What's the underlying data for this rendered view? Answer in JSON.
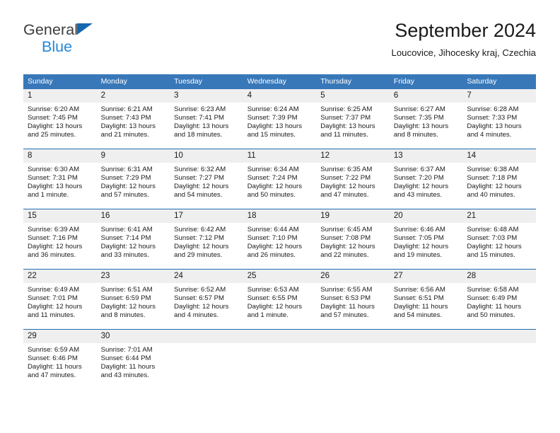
{
  "brand": {
    "name_part1": "General",
    "name_part2": "Blue",
    "triangle_icon": "triangle-icon",
    "accent_color": "#2387d6",
    "triangle_color": "#1567b0"
  },
  "header": {
    "title": "September 2024",
    "subtitle": "Loucovice, Jihocesky kraj, Czechia"
  },
  "calendar": {
    "header_bg": "#3878b9",
    "header_text_color": "#ffffff",
    "row_divider_color": "#1f6cb0",
    "daynum_bg": "#efefef",
    "weekdays": [
      "Sunday",
      "Monday",
      "Tuesday",
      "Wednesday",
      "Thursday",
      "Friday",
      "Saturday"
    ],
    "weeks": [
      [
        {
          "day": "1",
          "sunrise": "Sunrise: 6:20 AM",
          "sunset": "Sunset: 7:45 PM",
          "daylight_line1": "Daylight: 13 hours",
          "daylight_line2": "and 25 minutes."
        },
        {
          "day": "2",
          "sunrise": "Sunrise: 6:21 AM",
          "sunset": "Sunset: 7:43 PM",
          "daylight_line1": "Daylight: 13 hours",
          "daylight_line2": "and 21 minutes."
        },
        {
          "day": "3",
          "sunrise": "Sunrise: 6:23 AM",
          "sunset": "Sunset: 7:41 PM",
          "daylight_line1": "Daylight: 13 hours",
          "daylight_line2": "and 18 minutes."
        },
        {
          "day": "4",
          "sunrise": "Sunrise: 6:24 AM",
          "sunset": "Sunset: 7:39 PM",
          "daylight_line1": "Daylight: 13 hours",
          "daylight_line2": "and 15 minutes."
        },
        {
          "day": "5",
          "sunrise": "Sunrise: 6:25 AM",
          "sunset": "Sunset: 7:37 PM",
          "daylight_line1": "Daylight: 13 hours",
          "daylight_line2": "and 11 minutes."
        },
        {
          "day": "6",
          "sunrise": "Sunrise: 6:27 AM",
          "sunset": "Sunset: 7:35 PM",
          "daylight_line1": "Daylight: 13 hours",
          "daylight_line2": "and 8 minutes."
        },
        {
          "day": "7",
          "sunrise": "Sunrise: 6:28 AM",
          "sunset": "Sunset: 7:33 PM",
          "daylight_line1": "Daylight: 13 hours",
          "daylight_line2": "and 4 minutes."
        }
      ],
      [
        {
          "day": "8",
          "sunrise": "Sunrise: 6:30 AM",
          "sunset": "Sunset: 7:31 PM",
          "daylight_line1": "Daylight: 13 hours",
          "daylight_line2": "and 1 minute."
        },
        {
          "day": "9",
          "sunrise": "Sunrise: 6:31 AM",
          "sunset": "Sunset: 7:29 PM",
          "daylight_line1": "Daylight: 12 hours",
          "daylight_line2": "and 57 minutes."
        },
        {
          "day": "10",
          "sunrise": "Sunrise: 6:32 AM",
          "sunset": "Sunset: 7:27 PM",
          "daylight_line1": "Daylight: 12 hours",
          "daylight_line2": "and 54 minutes."
        },
        {
          "day": "11",
          "sunrise": "Sunrise: 6:34 AM",
          "sunset": "Sunset: 7:24 PM",
          "daylight_line1": "Daylight: 12 hours",
          "daylight_line2": "and 50 minutes."
        },
        {
          "day": "12",
          "sunrise": "Sunrise: 6:35 AM",
          "sunset": "Sunset: 7:22 PM",
          "daylight_line1": "Daylight: 12 hours",
          "daylight_line2": "and 47 minutes."
        },
        {
          "day": "13",
          "sunrise": "Sunrise: 6:37 AM",
          "sunset": "Sunset: 7:20 PM",
          "daylight_line1": "Daylight: 12 hours",
          "daylight_line2": "and 43 minutes."
        },
        {
          "day": "14",
          "sunrise": "Sunrise: 6:38 AM",
          "sunset": "Sunset: 7:18 PM",
          "daylight_line1": "Daylight: 12 hours",
          "daylight_line2": "and 40 minutes."
        }
      ],
      [
        {
          "day": "15",
          "sunrise": "Sunrise: 6:39 AM",
          "sunset": "Sunset: 7:16 PM",
          "daylight_line1": "Daylight: 12 hours",
          "daylight_line2": "and 36 minutes."
        },
        {
          "day": "16",
          "sunrise": "Sunrise: 6:41 AM",
          "sunset": "Sunset: 7:14 PM",
          "daylight_line1": "Daylight: 12 hours",
          "daylight_line2": "and 33 minutes."
        },
        {
          "day": "17",
          "sunrise": "Sunrise: 6:42 AM",
          "sunset": "Sunset: 7:12 PM",
          "daylight_line1": "Daylight: 12 hours",
          "daylight_line2": "and 29 minutes."
        },
        {
          "day": "18",
          "sunrise": "Sunrise: 6:44 AM",
          "sunset": "Sunset: 7:10 PM",
          "daylight_line1": "Daylight: 12 hours",
          "daylight_line2": "and 26 minutes."
        },
        {
          "day": "19",
          "sunrise": "Sunrise: 6:45 AM",
          "sunset": "Sunset: 7:08 PM",
          "daylight_line1": "Daylight: 12 hours",
          "daylight_line2": "and 22 minutes."
        },
        {
          "day": "20",
          "sunrise": "Sunrise: 6:46 AM",
          "sunset": "Sunset: 7:05 PM",
          "daylight_line1": "Daylight: 12 hours",
          "daylight_line2": "and 19 minutes."
        },
        {
          "day": "21",
          "sunrise": "Sunrise: 6:48 AM",
          "sunset": "Sunset: 7:03 PM",
          "daylight_line1": "Daylight: 12 hours",
          "daylight_line2": "and 15 minutes."
        }
      ],
      [
        {
          "day": "22",
          "sunrise": "Sunrise: 6:49 AM",
          "sunset": "Sunset: 7:01 PM",
          "daylight_line1": "Daylight: 12 hours",
          "daylight_line2": "and 11 minutes."
        },
        {
          "day": "23",
          "sunrise": "Sunrise: 6:51 AM",
          "sunset": "Sunset: 6:59 PM",
          "daylight_line1": "Daylight: 12 hours",
          "daylight_line2": "and 8 minutes."
        },
        {
          "day": "24",
          "sunrise": "Sunrise: 6:52 AM",
          "sunset": "Sunset: 6:57 PM",
          "daylight_line1": "Daylight: 12 hours",
          "daylight_line2": "and 4 minutes."
        },
        {
          "day": "25",
          "sunrise": "Sunrise: 6:53 AM",
          "sunset": "Sunset: 6:55 PM",
          "daylight_line1": "Daylight: 12 hours",
          "daylight_line2": "and 1 minute."
        },
        {
          "day": "26",
          "sunrise": "Sunrise: 6:55 AM",
          "sunset": "Sunset: 6:53 PM",
          "daylight_line1": "Daylight: 11 hours",
          "daylight_line2": "and 57 minutes."
        },
        {
          "day": "27",
          "sunrise": "Sunrise: 6:56 AM",
          "sunset": "Sunset: 6:51 PM",
          "daylight_line1": "Daylight: 11 hours",
          "daylight_line2": "and 54 minutes."
        },
        {
          "day": "28",
          "sunrise": "Sunrise: 6:58 AM",
          "sunset": "Sunset: 6:49 PM",
          "daylight_line1": "Daylight: 11 hours",
          "daylight_line2": "and 50 minutes."
        }
      ],
      [
        {
          "day": "29",
          "sunrise": "Sunrise: 6:59 AM",
          "sunset": "Sunset: 6:46 PM",
          "daylight_line1": "Daylight: 11 hours",
          "daylight_line2": "and 47 minutes."
        },
        {
          "day": "30",
          "sunrise": "Sunrise: 7:01 AM",
          "sunset": "Sunset: 6:44 PM",
          "daylight_line1": "Daylight: 11 hours",
          "daylight_line2": "and 43 minutes."
        },
        {
          "day": "",
          "sunrise": "",
          "sunset": "",
          "daylight_line1": "",
          "daylight_line2": ""
        },
        {
          "day": "",
          "sunrise": "",
          "sunset": "",
          "daylight_line1": "",
          "daylight_line2": ""
        },
        {
          "day": "",
          "sunrise": "",
          "sunset": "",
          "daylight_line1": "",
          "daylight_line2": ""
        },
        {
          "day": "",
          "sunrise": "",
          "sunset": "",
          "daylight_line1": "",
          "daylight_line2": ""
        },
        {
          "day": "",
          "sunrise": "",
          "sunset": "",
          "daylight_line1": "",
          "daylight_line2": ""
        }
      ]
    ]
  }
}
